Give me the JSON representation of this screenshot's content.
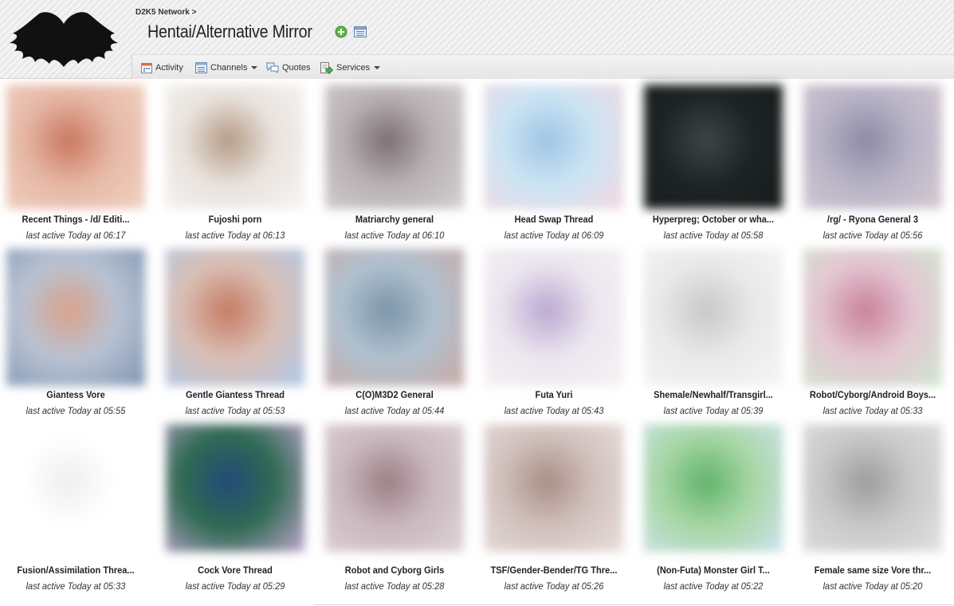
{
  "header": {
    "breadcrumb": "D2K5 Network >",
    "title": "Hentai/Alternative Mirror"
  },
  "toolbar": {
    "activity": "Activity",
    "channels": "Channels",
    "quotes": "Quotes",
    "services": "Services"
  },
  "threads": [
    {
      "title": "Recent Things - /d/ Editi...",
      "meta": "last active Today at 06:17",
      "colors": [
        "#e6b8a6",
        "#c9785f",
        "#f1d3c2"
      ]
    },
    {
      "title": "Fujoshi porn",
      "meta": "last active Today at 06:13",
      "colors": [
        "#e9e3de",
        "#b59b86",
        "#f7f4f2"
      ]
    },
    {
      "title": "Matriarchy general",
      "meta": "last active Today at 06:10",
      "colors": [
        "#b9b2b4",
        "#7d6f73",
        "#d4cfd0"
      ]
    },
    {
      "title": "Head Swap Thread",
      "meta": "last active Today at 06:09",
      "colors": [
        "#cbe4f3",
        "#9fc5e6",
        "#f2d7e1"
      ]
    },
    {
      "title": "Hyperpreg; October or wha...",
      "meta": "last active Today at 05:58",
      "colors": [
        "#1e2424",
        "#3d4646",
        "#151a1a"
      ]
    },
    {
      "title": "/rg/ - Ryona General 3",
      "meta": "last active Today at 05:56",
      "colors": [
        "#b8b3c6",
        "#8d8aa6",
        "#d8cbd3"
      ]
    },
    {
      "title": "Giantess Vore",
      "meta": "last active Today at 05:55",
      "colors": [
        "#b9c2d2",
        "#d9a28a",
        "#8096b3"
      ]
    },
    {
      "title": "Gentle Giantess Thread",
      "meta": "last active Today at 05:53",
      "colors": [
        "#d9bfb5",
        "#c67b63",
        "#aec8e8"
      ]
    },
    {
      "title": "C(O)M3D2 General",
      "meta": "last active Today at 05:44",
      "colors": [
        "#b0c1cf",
        "#7c95a9",
        "#c9a9a4"
      ]
    },
    {
      "title": "Futa Yuri",
      "meta": "last active Today at 05:43",
      "colors": [
        "#ece6ef",
        "#bba9d1",
        "#f6f2f4"
      ]
    },
    {
      "title": "Shemale/Newhalf/Transgirl...",
      "meta": "last active Today at 05:39",
      "colors": [
        "#e9e9e9",
        "#c8c8c8",
        "#f6f6f6"
      ]
    },
    {
      "title": "Robot/Cyborg/Android Boys...",
      "meta": "last active Today at 05:33",
      "colors": [
        "#e3c6d2",
        "#c9829b",
        "#cfe8cf"
      ]
    },
    {
      "title": "Fusion/Assimilation Threa...",
      "meta": "last active Today at 05:33",
      "colors": [
        "#ffffff",
        "#efefef",
        "#ffffff"
      ]
    },
    {
      "title": "Cock Vore Thread",
      "meta": "last active Today at 05:29",
      "colors": [
        "#2f6a52",
        "#224a78",
        "#c2a6cf"
      ]
    },
    {
      "title": "Robot and Cyborg Girls",
      "meta": "last active Today at 05:28",
      "colors": [
        "#cab9bf",
        "#9d7f86",
        "#dfd3d6"
      ]
    },
    {
      "title": "TSF/Gender-Bender/TG Thre...",
      "meta": "last active Today at 05:26",
      "colors": [
        "#d1c1bd",
        "#a98e86",
        "#e8dedb"
      ]
    },
    {
      "title": "(Non-Futa) Monster Girl T...",
      "meta": "last active Today at 05:22",
      "colors": [
        "#a7d7a5",
        "#62b36b",
        "#cfe2ef"
      ]
    },
    {
      "title": "Female same size Vore thr...",
      "meta": "last active Today at 05:20",
      "colors": [
        "#c9c9c9",
        "#9d9d9d",
        "#e1e1e1"
      ]
    }
  ]
}
